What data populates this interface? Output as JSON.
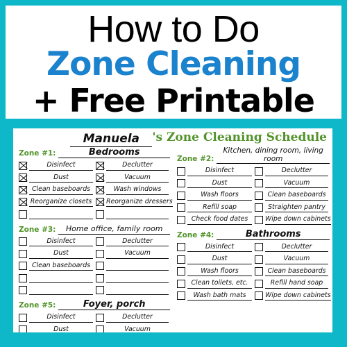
{
  "poster": {
    "border_color": "#0fb8c9",
    "title_line1": "How to Do",
    "title_line2": "Zone Cleaning",
    "title_line3": "+ Free Printable",
    "title_line1_color": "#000000",
    "title_line2_color": "#1b82cd",
    "title_line3_color": "#000000"
  },
  "sheet": {
    "name_value": "Manuela",
    "title_suffix": "'s Zone Cleaning Schedule",
    "title_color": "#52942b",
    "zone_label_color": "#52942b",
    "zones": [
      {
        "label": "Zone #1:",
        "value": "Bedrooms",
        "value_style": "normal",
        "column": "left",
        "rows": [
          {
            "left": {
              "text": "Disinfect",
              "checked": true
            },
            "right": {
              "text": "Declutter",
              "checked": true
            }
          },
          {
            "left": {
              "text": "Dust",
              "checked": true
            },
            "right": {
              "text": "Vacuum",
              "checked": true
            }
          },
          {
            "left": {
              "text": "Clean baseboards",
              "checked": true
            },
            "right": {
              "text": "Wash windows",
              "checked": true
            }
          },
          {
            "left": {
              "text": "Reorganize closets",
              "checked": true
            },
            "right": {
              "text": "Reorganize dressers",
              "checked": true
            }
          },
          {
            "left": {
              "text": "",
              "checked": false
            },
            "right": {
              "text": "",
              "checked": false
            }
          }
        ]
      },
      {
        "label": "Zone #2:",
        "value": "Kitchen, dining room, living room",
        "value_style": "two-line",
        "column": "right",
        "rows": [
          {
            "left": {
              "text": "Disinfect",
              "checked": false
            },
            "right": {
              "text": "Declutter",
              "checked": false
            }
          },
          {
            "left": {
              "text": "Dust",
              "checked": false
            },
            "right": {
              "text": "Vacuum",
              "checked": false
            }
          },
          {
            "left": {
              "text": "Wash floors",
              "checked": false
            },
            "right": {
              "text": "Clean baseboards",
              "checked": false
            }
          },
          {
            "left": {
              "text": "Refill soap",
              "checked": false
            },
            "right": {
              "text": "Straighten pantry",
              "checked": false
            }
          },
          {
            "left": {
              "text": "Check food dates",
              "checked": false
            },
            "right": {
              "text": "Wipe down cabinets",
              "checked": false
            }
          }
        ]
      },
      {
        "label": "Zone #3:",
        "value": "Home office, family room",
        "value_style": "small",
        "column": "left",
        "rows": [
          {
            "left": {
              "text": "Disinfect",
              "checked": false
            },
            "right": {
              "text": "Declutter",
              "checked": false
            }
          },
          {
            "left": {
              "text": "Dust",
              "checked": false
            },
            "right": {
              "text": "Vacuum",
              "checked": false
            }
          },
          {
            "left": {
              "text": "Clean baseboards",
              "checked": false
            },
            "right": {
              "text": "",
              "checked": false
            }
          },
          {
            "left": {
              "text": "",
              "checked": false
            },
            "right": {
              "text": "",
              "checked": false
            }
          },
          {
            "left": {
              "text": "",
              "checked": false
            },
            "right": {
              "text": "",
              "checked": false
            }
          }
        ]
      },
      {
        "label": "Zone #4:",
        "value": "Bathrooms",
        "value_style": "normal",
        "column": "right",
        "rows": [
          {
            "left": {
              "text": "Disinfect",
              "checked": false
            },
            "right": {
              "text": "Declutter",
              "checked": false
            }
          },
          {
            "left": {
              "text": "Dust",
              "checked": false
            },
            "right": {
              "text": "Vacuum",
              "checked": false
            }
          },
          {
            "left": {
              "text": "Wash floors",
              "checked": false
            },
            "right": {
              "text": "Clean baseboards",
              "checked": false
            }
          },
          {
            "left": {
              "text": "Clean toilets, etc.",
              "checked": false
            },
            "right": {
              "text": "Refill hand soap",
              "checked": false
            }
          },
          {
            "left": {
              "text": "Wash bath mats",
              "checked": false
            },
            "right": {
              "text": "Wipe down cabinets",
              "checked": false
            }
          }
        ]
      },
      {
        "label": "Zone #5:",
        "value": "Foyer, porch",
        "value_style": "normal",
        "column": "left",
        "rows": [
          {
            "left": {
              "text": "Disinfect",
              "checked": false
            },
            "right": {
              "text": "Declutter",
              "checked": false
            }
          },
          {
            "left": {
              "text": "Dust",
              "checked": false
            },
            "right": {
              "text": "Vacuum",
              "checked": false
            }
          }
        ]
      }
    ]
  }
}
